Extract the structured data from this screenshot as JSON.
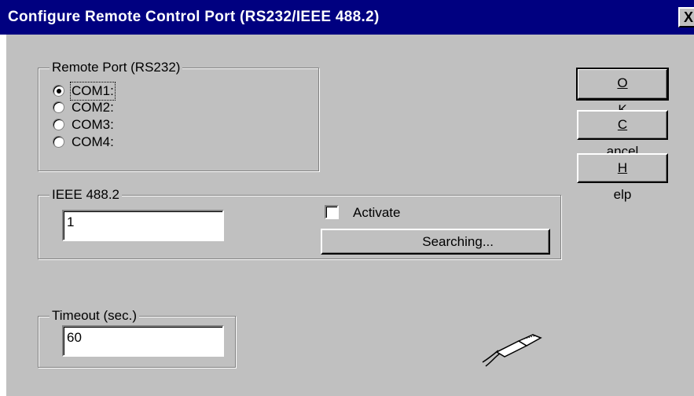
{
  "window": {
    "title": "Configure Remote Control Port (RS232/IEEE 488.2)",
    "close_glyph": "X"
  },
  "remote_port": {
    "legend": "Remote Port (RS232)",
    "options": [
      {
        "label": "COM1:",
        "selected": true
      },
      {
        "label": "COM2:",
        "selected": false
      },
      {
        "label": "COM3:",
        "selected": false
      },
      {
        "label": "COM4:",
        "selected": false
      }
    ]
  },
  "ieee": {
    "legend": "IEEE 488.2",
    "address_value": "1",
    "activate_label": "Activate",
    "activate_checked": false,
    "search_button": "Searching..."
  },
  "timeout": {
    "legend": "Timeout (sec.)",
    "value": "60"
  },
  "buttons": {
    "ok": {
      "mnemonic": "O",
      "rest": "K"
    },
    "cancel": {
      "mnemonic": "C",
      "rest": "ancel"
    },
    "help": {
      "mnemonic": "H",
      "rest": "elp"
    }
  },
  "icons": {
    "cable": "serial-cable-icon"
  }
}
